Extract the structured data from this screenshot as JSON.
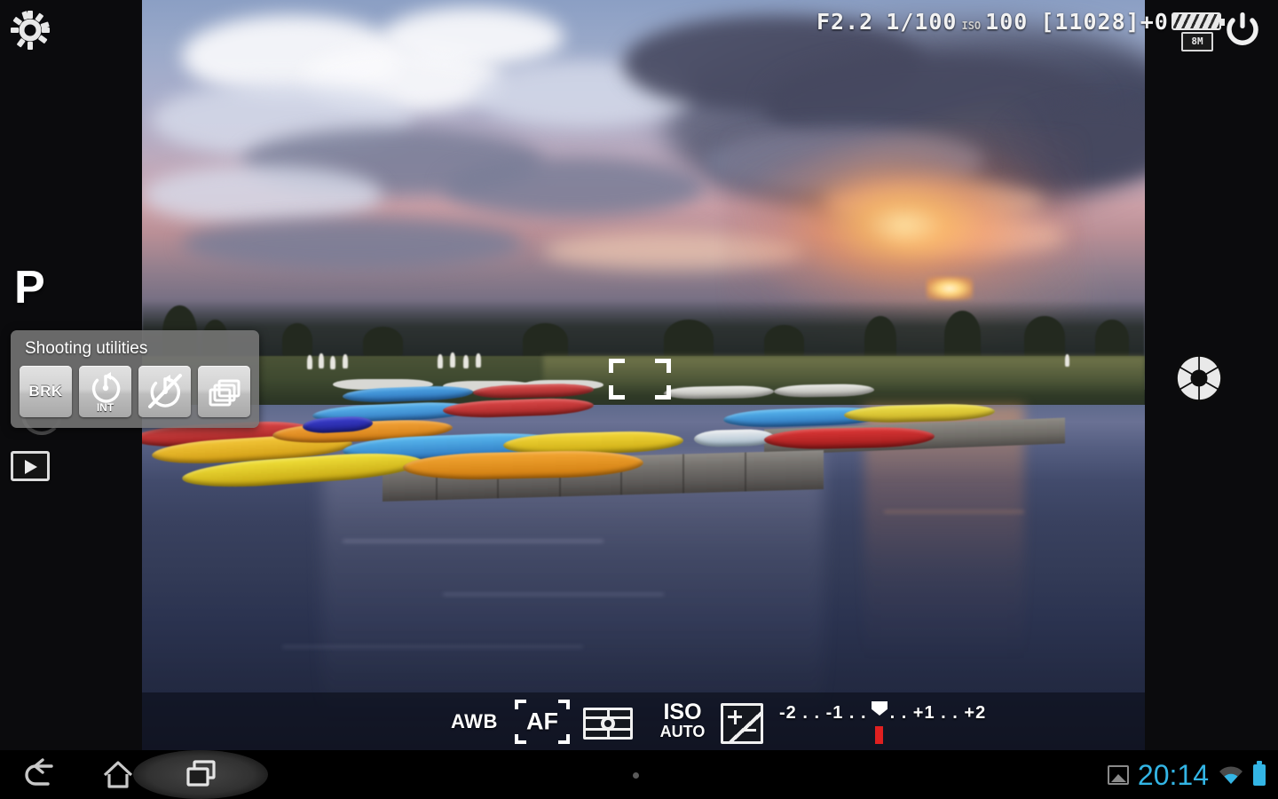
{
  "app": {
    "name": "camera-viewfinder",
    "mode_indicator": "P"
  },
  "lcd_status": {
    "aperture": "F2.2",
    "shutter_speed": "1/100",
    "iso_label": "ISO",
    "iso_value": "100",
    "shots_remaining": "[11028]",
    "exposure_offset": "+0",
    "resolution_badge": "8M"
  },
  "icons": {
    "settings": "gear-icon",
    "power": "power-icon",
    "shutter": "aperture-shutter-icon",
    "playback": "play-review-icon",
    "battery": "battery-icon",
    "gallery": "gallery-image-icon",
    "wifi": "wifi-icon",
    "system_battery": "system-battery-icon",
    "back": "back-arrow-icon",
    "home": "home-icon",
    "recents": "recent-apps-icon"
  },
  "utilities_panel": {
    "title": "Shooting utilities",
    "buttons": [
      {
        "id": "bracketing",
        "label": "BRK",
        "sub": "",
        "icon": "bracketing-icon"
      },
      {
        "id": "interval-timer",
        "label": "",
        "sub": "INT",
        "icon": "interval-timer-icon"
      },
      {
        "id": "self-timer-off",
        "label": "",
        "sub": "",
        "icon": "self-timer-disabled-icon"
      },
      {
        "id": "burst-mode",
        "label": "",
        "sub": "",
        "icon": "burst-continuous-icon"
      }
    ]
  },
  "bottom_toolbar": {
    "white_balance": "AWB",
    "focus_mode": "AF",
    "metering_mode": "center-weighted-metering-icon",
    "iso_top": "ISO",
    "iso_bottom": "AUTO",
    "exposure_comp_icon": "exposure-compensation-icon",
    "ev_scale_text": "-2 . . -1 . .      . . +1 . . +2",
    "ev_scale_left": "-2 . . -1 . .",
    "ev_scale_right": ". . +1 . . +2",
    "ev_current": "0"
  },
  "system_bar": {
    "clock": "20:14"
  },
  "colors": {
    "accent": "#33b5e5",
    "ev_marker": "#e02020",
    "panel_bg": "#767676",
    "chrome_bg": "#0b0b0d"
  }
}
